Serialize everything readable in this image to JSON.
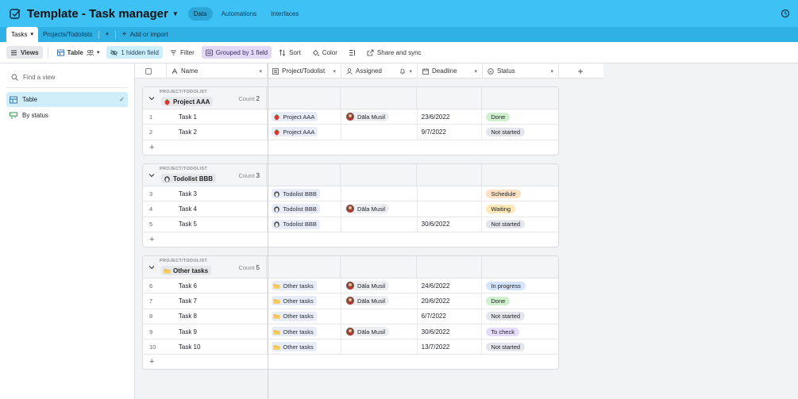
{
  "app": {
    "title": "Template - Task manager",
    "nav": [
      {
        "label": "Data",
        "active": true
      },
      {
        "label": "Automations",
        "active": false
      },
      {
        "label": "Interfaces",
        "active": false
      }
    ]
  },
  "tabs": {
    "active": "Tasks",
    "other": "Projects/Todolists",
    "add_label": "Add or import"
  },
  "toolbar": {
    "views": "Views",
    "view_type": "Table",
    "hidden": "1 hidden field",
    "filter": "Filter",
    "grouped": "Grouped by 1 field",
    "sort": "Sort",
    "color": "Color",
    "share": "Share and sync"
  },
  "sidebar": {
    "find_placeholder": "Find a view",
    "views": [
      {
        "label": "Table",
        "active": true
      },
      {
        "label": "By status",
        "active": false
      }
    ]
  },
  "columns": {
    "name": "Name",
    "project": "Project/Todolist",
    "assigned": "Assigned",
    "deadline": "Deadline",
    "status": "Status"
  },
  "status_colors": {
    "Done": "#cfefcf",
    "Not started": "#e3e6ec",
    "Schedule": "#fde0c3",
    "Waiting": "#fde9b8",
    "In progress": "#d3e4fb",
    "To check": "#e4dcfa"
  },
  "groups": [
    {
      "field": "PROJECT/TODOLIST",
      "value": "Project AAA",
      "icon": "strawberry-icon",
      "count_label": "Count",
      "count": "2",
      "rows": [
        {
          "num": "1",
          "name": "Task 1",
          "project": "Project AAA",
          "assigned": "Dāla Musil",
          "deadline": "23/6/2022",
          "status": "Done"
        },
        {
          "num": "2",
          "name": "Task 2",
          "project": "Project AAA",
          "assigned": "",
          "deadline": "9/7/2022",
          "status": "Not started"
        }
      ]
    },
    {
      "field": "PROJECT/TODOLIST",
      "value": "Todolist BBB",
      "icon": "penguin-icon",
      "count_label": "Count",
      "count": "3",
      "rows": [
        {
          "num": "3",
          "name": "Task 3",
          "project": "Todolist BBB",
          "assigned": "",
          "deadline": "",
          "status": "Schedule"
        },
        {
          "num": "4",
          "name": "Task 4",
          "project": "Todolist BBB",
          "assigned": "Dāla Musil",
          "deadline": "",
          "status": "Waiting"
        },
        {
          "num": "5",
          "name": "Task 5",
          "project": "Todolist BBB",
          "assigned": "",
          "deadline": "30/6/2022",
          "status": "Not started"
        }
      ]
    },
    {
      "field": "PROJECT/TODOLIST",
      "value": "Other tasks",
      "icon": "folder-icon",
      "count_label": "Count",
      "count": "5",
      "rows": [
        {
          "num": "6",
          "name": "Task 6",
          "project": "Other tasks",
          "assigned": "Dāla Musil",
          "deadline": "24/6/2022",
          "status": "In progress"
        },
        {
          "num": "7",
          "name": "Task 7",
          "project": "Other tasks",
          "assigned": "Dāla Musil",
          "deadline": "20/6/2022",
          "status": "Done"
        },
        {
          "num": "8",
          "name": "Task 8",
          "project": "Other tasks",
          "assigned": "",
          "deadline": "6/7/2022",
          "status": "Not started"
        },
        {
          "num": "9",
          "name": "Task 9",
          "project": "Other tasks",
          "assigned": "Dāla Musil",
          "deadline": "30/6/2022",
          "status": "To check"
        },
        {
          "num": "10",
          "name": "Task 10",
          "project": "Other tasks",
          "assigned": "",
          "deadline": "13/7/2022",
          "status": "Not started"
        }
      ]
    }
  ]
}
